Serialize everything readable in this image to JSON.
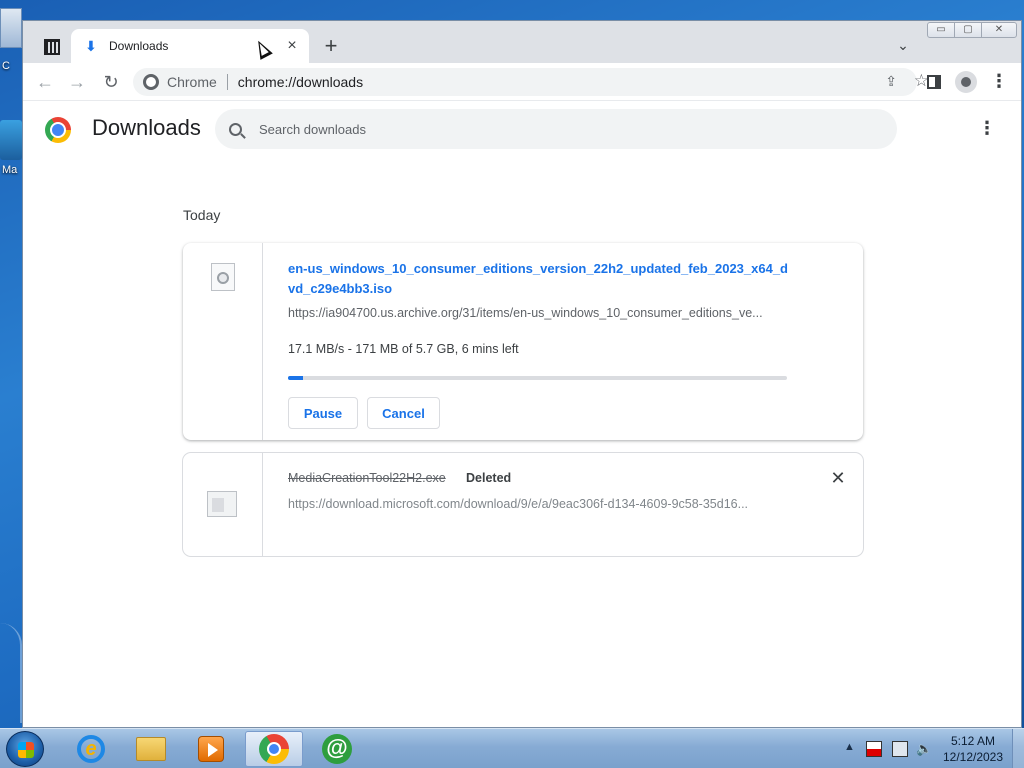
{
  "desktop": {
    "icon_labels": [
      "C",
      "Ma"
    ]
  },
  "window": {
    "controls": {
      "minimize": "▭",
      "maximize": "▢",
      "close": "✕"
    }
  },
  "tabs": [
    {
      "title": "Downloads",
      "icon": "download-icon",
      "close": "×"
    }
  ],
  "tabbar": {
    "new_tab": "+",
    "tab_search": "⌄"
  },
  "toolbar": {
    "back": "←",
    "forward": "→",
    "reload": "↻",
    "omnibox": {
      "scheme_label": "Chrome",
      "url": "chrome://downloads",
      "share": "⇪",
      "bookmark": "☆"
    },
    "menu": "⋮"
  },
  "page": {
    "title": "Downloads",
    "search": {
      "placeholder": "Search downloads",
      "value": ""
    },
    "menu": "⋮",
    "date_group": "Today",
    "downloads": [
      {
        "filename": "en-us_windows_10_consumer_editions_version_22h2_updated_feb_2023_x64_dvd_c29e4bb3.iso",
        "url": "https://ia904700.us.archive.org/31/items/en-us_windows_10_consumer_editions_ve...",
        "status": "17.1 MB/s - 171 MB of 5.7 GB, 6 mins left",
        "progress_percent": 3,
        "actions": {
          "pause": "Pause",
          "cancel": "Cancel"
        }
      },
      {
        "filename": "MediaCreationTool22H2.exe",
        "state": "Deleted",
        "url": "https://download.microsoft.com/download/9/e/a/9eac306f-d134-4609-9c58-35d16...",
        "remove": "✕"
      }
    ]
  },
  "taskbar": {
    "pinned": [
      "ie-icon",
      "explorer-folder-icon",
      "media-player-icon",
      "chrome-icon",
      "mail-at-icon"
    ],
    "active": "chrome-icon",
    "tray": {
      "chevron": "▲",
      "volume": "🔈"
    },
    "clock": {
      "time": "5:12 AM",
      "date": "12/12/2023"
    }
  },
  "colors": {
    "accent": "#1a73e8",
    "tabbar": "#dee1e6",
    "omnibox": "#f1f3f4",
    "progress_track": "#dadce0"
  }
}
